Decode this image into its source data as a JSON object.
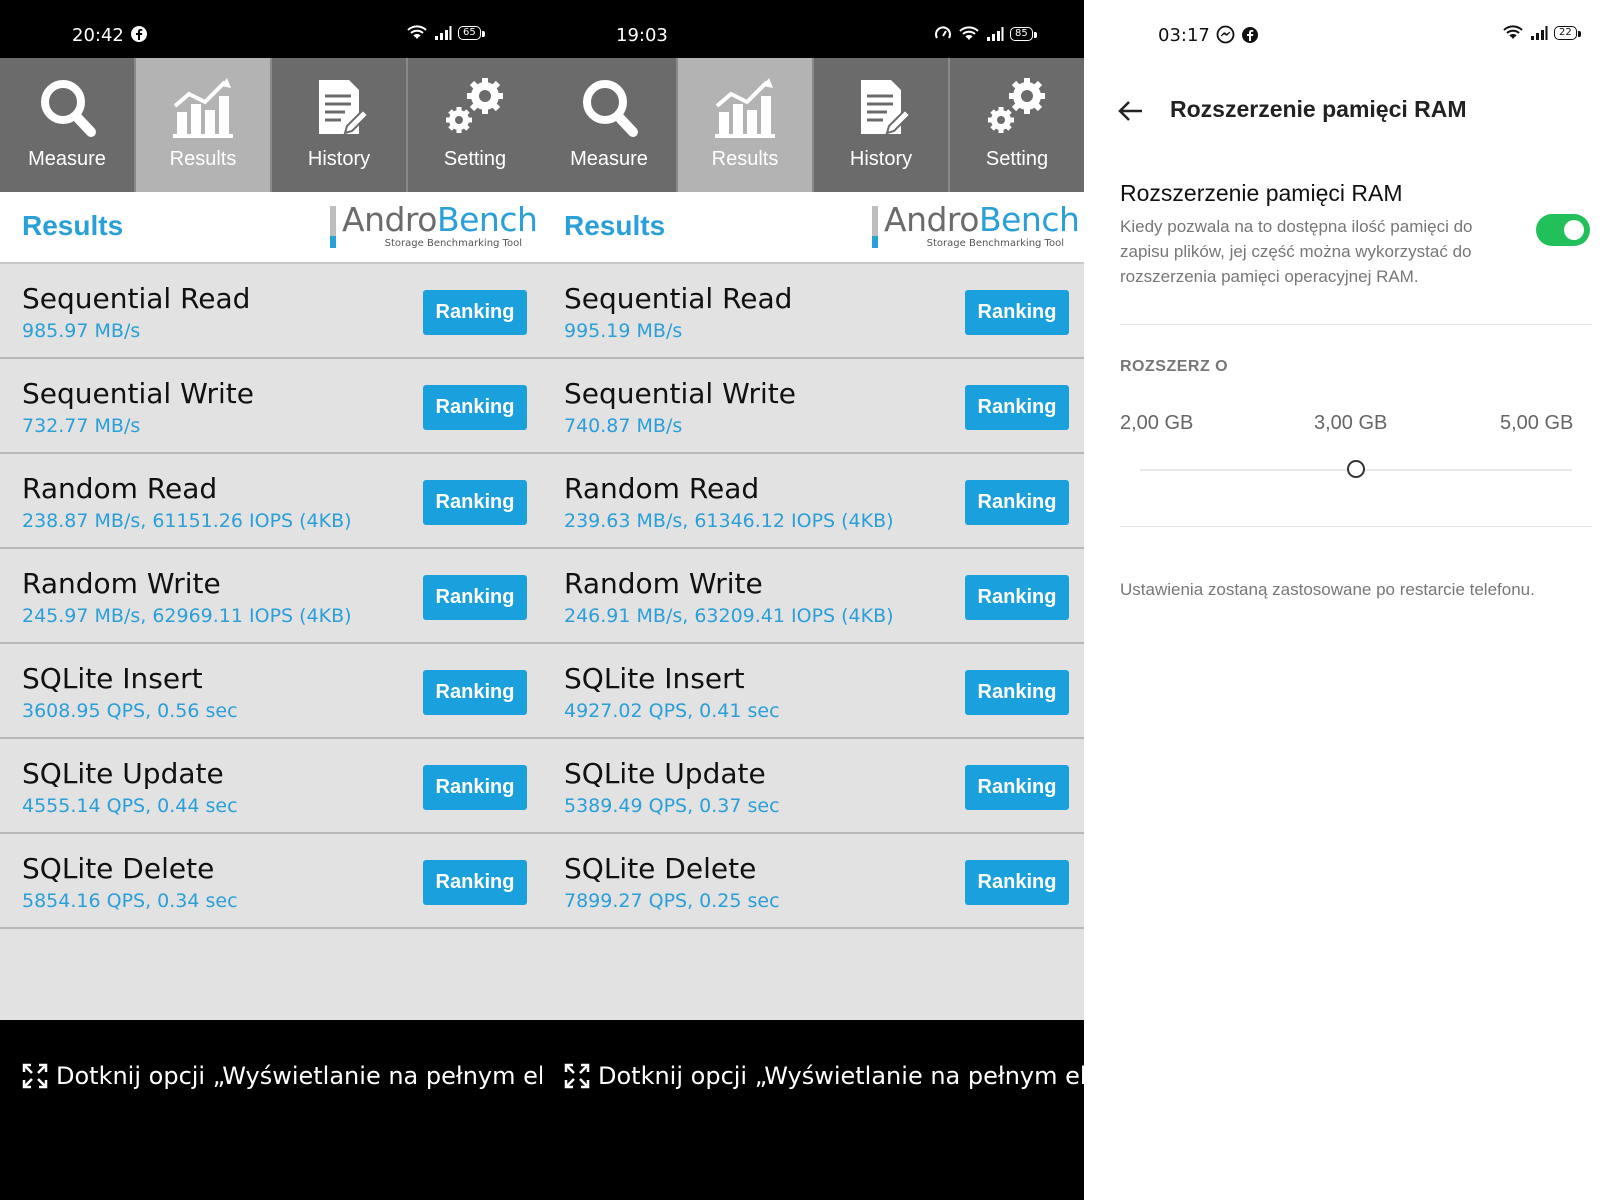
{
  "colors": {
    "accent": "#2a9fd8",
    "tab_bg": "#6b6b6b",
    "tab_active": "#b3b3b3",
    "toggle_on": "#21c05a"
  },
  "panels": [
    {
      "status": {
        "time": "20:42",
        "battery": "65",
        "icons": [
          "facebook-icon",
          "wifi-icon",
          "signal-icon",
          "battery-icon"
        ]
      },
      "tabs": [
        {
          "label": "Measure",
          "icon": "magnifier-icon"
        },
        {
          "label": "Results",
          "icon": "chart-icon"
        },
        {
          "label": "History",
          "icon": "document-icon"
        },
        {
          "label": "Setting",
          "icon": "gears-icon"
        }
      ],
      "active_tab": "Results",
      "header": {
        "title": "Results",
        "logo_part1": "Andro",
        "logo_part2": "Bench",
        "logo_sub": "Storage Benchmarking Tool"
      },
      "rows": [
        {
          "name": "Sequential Read",
          "value": "985.97 MB/s",
          "button": "Ranking"
        },
        {
          "name": "Sequential Write",
          "value": "732.77 MB/s",
          "button": "Ranking"
        },
        {
          "name": "Random Read",
          "value": "238.87 MB/s, 61151.26 IOPS (4KB)",
          "button": "Ranking"
        },
        {
          "name": "Random Write",
          "value": "245.97 MB/s, 62969.11 IOPS (4KB)",
          "button": "Ranking"
        },
        {
          "name": "SQLite Insert",
          "value": "3608.95 QPS, 0.56 sec",
          "button": "Ranking"
        },
        {
          "name": "SQLite Update",
          "value": "4555.14 QPS, 0.44 sec",
          "button": "Ranking"
        },
        {
          "name": "SQLite Delete",
          "value": "5854.16 QPS, 0.34 sec",
          "button": "Ranking"
        }
      ],
      "hint": "Dotknij opcji „Wyświetlanie na pełnym ekr..."
    },
    {
      "status": {
        "time": "19:03",
        "battery": "85",
        "icons": [
          "speedometer-icon",
          "wifi-icon",
          "signal-icon",
          "battery-icon"
        ]
      },
      "tabs": [
        {
          "label": "Measure",
          "icon": "magnifier-icon"
        },
        {
          "label": "Results",
          "icon": "chart-icon"
        },
        {
          "label": "History",
          "icon": "document-icon"
        },
        {
          "label": "Setting",
          "icon": "gears-icon"
        }
      ],
      "active_tab": "Results",
      "header": {
        "title": "Results",
        "logo_part1": "Andro",
        "logo_part2": "Bench",
        "logo_sub": "Storage Benchmarking Tool"
      },
      "rows": [
        {
          "name": "Sequential Read",
          "value": "995.19 MB/s",
          "button": "Ranking"
        },
        {
          "name": "Sequential Write",
          "value": "740.87 MB/s",
          "button": "Ranking"
        },
        {
          "name": "Random Read",
          "value": "239.63 MB/s, 61346.12 IOPS (4KB)",
          "button": "Ranking"
        },
        {
          "name": "Random Write",
          "value": "246.91 MB/s, 63209.41 IOPS (4KB)",
          "button": "Ranking"
        },
        {
          "name": "SQLite Insert",
          "value": "4927.02 QPS, 0.41 sec",
          "button": "Ranking"
        },
        {
          "name": "SQLite Update",
          "value": "5389.49 QPS, 0.37 sec",
          "button": "Ranking"
        },
        {
          "name": "SQLite Delete",
          "value": "7899.27 QPS, 0.25 sec",
          "button": "Ranking"
        }
      ],
      "hint": "Dotknij opcji „Wyświetlanie na pełnym ekr..."
    }
  ],
  "settings": {
    "status": {
      "time": "03:17",
      "battery": "22",
      "icons": [
        "messenger-icon",
        "facebook-icon",
        "wifi-icon",
        "signal-icon",
        "battery-icon"
      ]
    },
    "title": "Rozszerzenie pamięci RAM",
    "option_title": "Rozszerzenie pamięci RAM",
    "option_desc": "Kiedy pozwala na to dostępna ilość pamięci do zapisu plików, jej część można wykorzystać do rozszerzenia pamięci operacyjnej RAM.",
    "toggle_on": true,
    "section_label": "ROZSZERZ O",
    "ticks": [
      "2,00 GB",
      "3,00 GB",
      "5,00 GB"
    ],
    "selected_tick": "3,00 GB",
    "slider_fraction": 0.5,
    "note": "Ustawienia zostaną zastosowane po restarcie telefonu."
  }
}
